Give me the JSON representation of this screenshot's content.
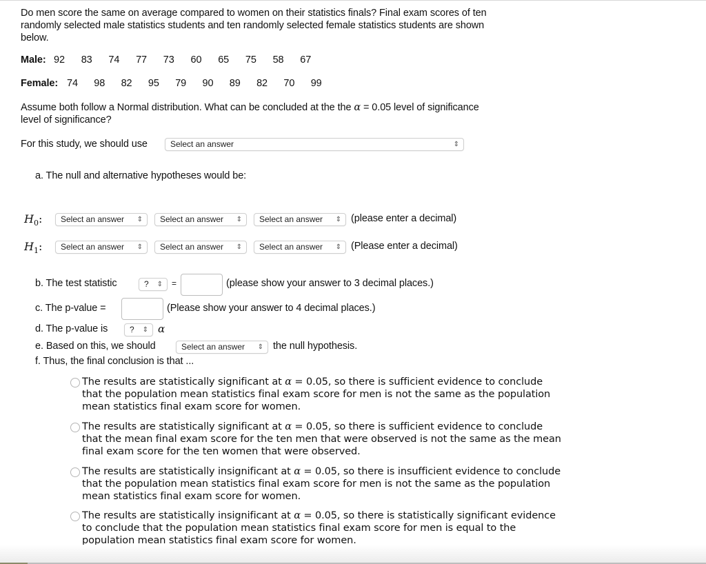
{
  "question": {
    "intro": "Do men score the same on average compared to women on their statistics finals? Final exam scores of ten randomly selected male statistics students and ten randomly selected female statistics students are shown below.",
    "intro_lines": [
      "Do men score the same on average compared to women on their statistics finals? Final exam scores of ten",
      "randomly selected male statistics students and ten randomly selected female statistics students are shown",
      "below."
    ],
    "male_label": "Male:",
    "male_scores": [
      "92",
      "83",
      "74",
      "77",
      "73",
      "60",
      "65",
      "75",
      "58",
      "67"
    ],
    "female_label": "Female:",
    "female_scores": [
      "74",
      "98",
      "82",
      "95",
      "79",
      "90",
      "89",
      "82",
      "70",
      "99"
    ],
    "assume_line1_a": "Assume both follow a Normal distribution.  What can be concluded at the the",
    "alpha_symbol": "α",
    "assume_line1_b": "= 0.05 level of significance",
    "assume_line2": "level of significance?"
  },
  "study": {
    "label": "For this study, we should use",
    "select_value": "Select an answer"
  },
  "part_a": {
    "label": "a.  The null and alternative hypotheses would be:",
    "h0": {
      "symbol": "H",
      "sub": "0",
      "colon": ":",
      "selects": [
        "Select an answer",
        "Select an answer",
        "Select an answer"
      ],
      "hint": "(please enter a decimal)"
    },
    "h1": {
      "symbol": "H",
      "sub": "1",
      "colon": ":",
      "selects": [
        "Select an answer",
        "Select an answer",
        "Select an answer"
      ],
      "hint": "(Please enter a decimal)"
    }
  },
  "part_b": {
    "label": "b.  The test statistic",
    "select_value": "?",
    "equals": "=",
    "input_value": "",
    "hint": "(please show your answer to 3 decimal places.)"
  },
  "part_c": {
    "label": "c.  The p-value =",
    "input_value": "",
    "hint": "(Please show your answer to 4 decimal places.)"
  },
  "part_d": {
    "label": "d.  The p-value is",
    "select_value": "?",
    "alpha": "α"
  },
  "part_e": {
    "label": "e.  Based on this, we should",
    "select_value": "Select an answer",
    "suffix": "the null hypothesis."
  },
  "part_f": {
    "label": "f.  Thus, the final conclusion is that ...",
    "options": [
      {
        "selected": false,
        "lines": [
          "The results are statistically significant at α = 0.05, so there is sufficient evidence to conclude",
          "that the population mean statistics final exam score for men is not the same as the population",
          "mean statistics final exam score for women."
        ]
      },
      {
        "selected": false,
        "lines": [
          "The results are statistically significant at α = 0.05, so there is sufficient evidence to conclude",
          "that the mean final exam score for the ten men that were observed is not the same as the mean",
          "final exam score for the ten women that were observed."
        ]
      },
      {
        "selected": false,
        "lines": [
          "The results are statistically insignificant at α = 0.05, so there is insufficient evidence to conclude",
          "that the population mean statistics final exam score for men is not the same as the population",
          "mean statistics final exam score for women."
        ]
      },
      {
        "selected": false,
        "lines": [
          "The results are statistically insignificant at α = 0.05, so there is statistically significant evidence",
          "to conclude that the population mean statistics final exam score for men is equal to the",
          "population mean statistics final exam score for women."
        ]
      }
    ]
  },
  "icons": {
    "select_chevron": "⇕"
  }
}
